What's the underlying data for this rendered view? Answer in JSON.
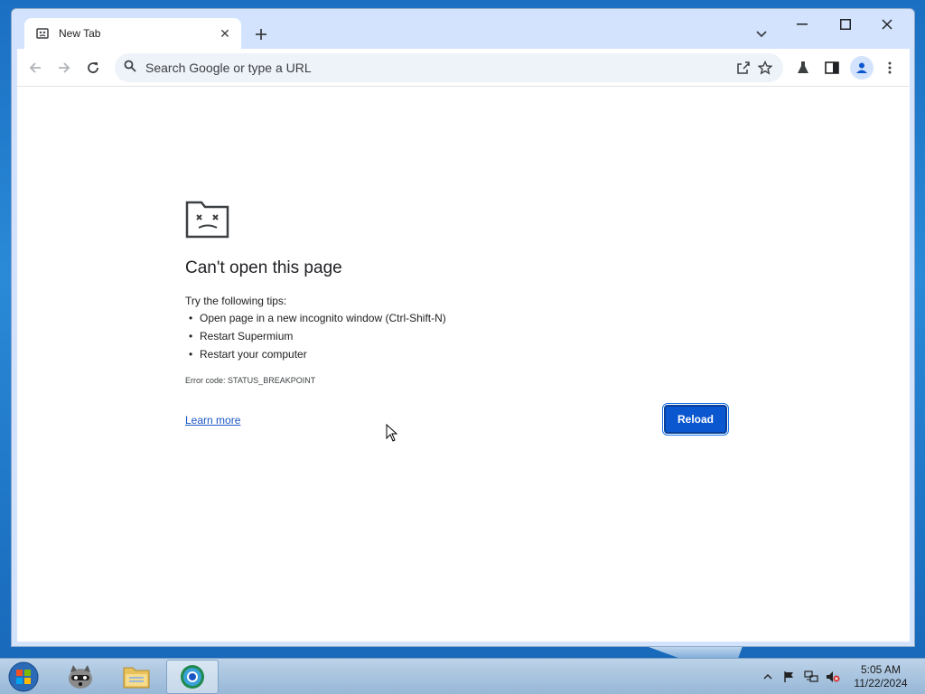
{
  "browser": {
    "tab": {
      "title": "New Tab"
    },
    "omnibox": {
      "placeholder": "Search Google or type a URL"
    }
  },
  "error_page": {
    "title": "Can't open this page",
    "tips_intro": "Try the following tips:",
    "tips": [
      "Open page in a new incognito window (Ctrl-Shift-N)",
      "Restart Supermium",
      "Restart your computer"
    ],
    "error_code": "Error code: STATUS_BREAKPOINT",
    "learn_more": "Learn more",
    "reload": "Reload"
  },
  "taskbar": {
    "clock_time": "5:05 AM",
    "clock_date": "11/22/2024"
  },
  "colors": {
    "accent": "#0b57d0",
    "link": "#1a56c4",
    "tabstrip": "#d3e3fd"
  }
}
